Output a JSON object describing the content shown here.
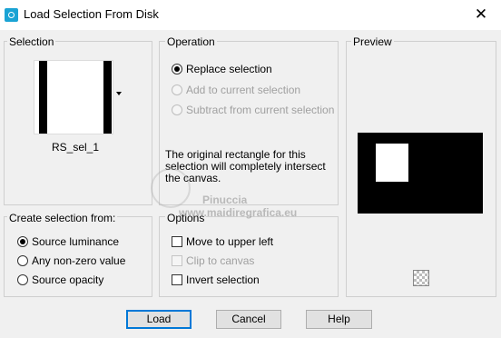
{
  "window": {
    "title": "Load Selection From Disk",
    "close_glyph": "✕"
  },
  "selection": {
    "label": "Selection",
    "name": "RS_sel_1"
  },
  "operation": {
    "label": "Operation",
    "options": [
      {
        "label": "Replace selection",
        "checked": true,
        "enabled": true
      },
      {
        "label": "Add to current selection",
        "checked": false,
        "enabled": false
      },
      {
        "label": "Subtract from current selection",
        "checked": false,
        "enabled": false
      }
    ],
    "info_lines": [
      "The original rectangle for this",
      "selection will completely intersect",
      "the canvas."
    ]
  },
  "preview": {
    "label": "Preview"
  },
  "create_from": {
    "label": "Create selection from:",
    "options": [
      {
        "label": "Source luminance",
        "checked": true
      },
      {
        "label": "Any non-zero value",
        "checked": false
      },
      {
        "label": "Source opacity",
        "checked": false
      }
    ]
  },
  "options": {
    "label": "Options",
    "items": [
      {
        "label": "Move to upper left",
        "checked": false,
        "enabled": true
      },
      {
        "label": "Clip to canvas",
        "checked": false,
        "enabled": false
      },
      {
        "label": "Invert selection",
        "checked": false,
        "enabled": true
      }
    ]
  },
  "watermark": {
    "line1": "Pinuccia",
    "line2": "www.maidiregrafica.eu"
  },
  "buttons": {
    "load": "Load",
    "cancel": "Cancel",
    "help": "Help"
  },
  "colors": {
    "accent": "#0078d7",
    "app_icon": "#1aa3d4",
    "disabled_text": "#a0a0a0"
  }
}
